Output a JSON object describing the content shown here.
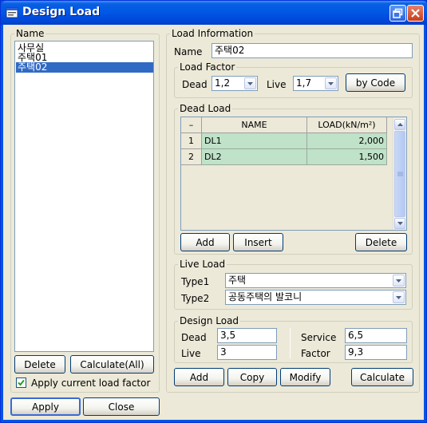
{
  "window": {
    "title": "Design Load"
  },
  "name_panel": {
    "title": "Name",
    "items": [
      {
        "label": "사무실",
        "selected": false
      },
      {
        "label": "주택01",
        "selected": false
      },
      {
        "label": "주택02",
        "selected": true
      }
    ],
    "delete_label": "Delete",
    "calculate_all_label": "Calculate(All)",
    "apply_factor_label": "Apply current load factor",
    "apply_factor_checked": true
  },
  "load_info": {
    "title": "Load Information",
    "name_label": "Name",
    "name_value": "주택02"
  },
  "load_factor": {
    "title": "Load Factor",
    "dead_label": "Dead",
    "dead_value": "1,2",
    "live_label": "Live",
    "live_value": "1,7",
    "by_code_label": "by Code"
  },
  "dead_load": {
    "title": "Dead Load",
    "columns": [
      "–",
      "NAME",
      "LOAD(kN/m²)"
    ],
    "rows": [
      {
        "no": "1",
        "name": "DL1",
        "load": "2,000"
      },
      {
        "no": "2",
        "name": "DL2",
        "load": "1,500"
      }
    ],
    "add_label": "Add",
    "insert_label": "Insert",
    "delete_label": "Delete"
  },
  "live_load": {
    "title": "Live Load",
    "type1_label": "Type1",
    "type1_value": "주택",
    "type2_label": "Type2",
    "type2_value": "공동주택의 발코니"
  },
  "design_load": {
    "title": "Design Load",
    "dead_label": "Dead",
    "dead_value": "3,5",
    "live_label": "Live",
    "live_value": "3",
    "service_label": "Service",
    "service_value": "6,5",
    "factor_label": "Factor",
    "factor_value": "9,3"
  },
  "actions": {
    "add_label": "Add",
    "copy_label": "Copy",
    "modify_label": "Modify",
    "calculate_label": "Calculate"
  },
  "bottom": {
    "apply_label": "Apply",
    "close_label": "Close"
  },
  "colors": {
    "titlebar": "#0058e6",
    "selection": "#316ac5",
    "grid_row": "#bfe2c8",
    "dialog_bg": "#ece9d8"
  }
}
